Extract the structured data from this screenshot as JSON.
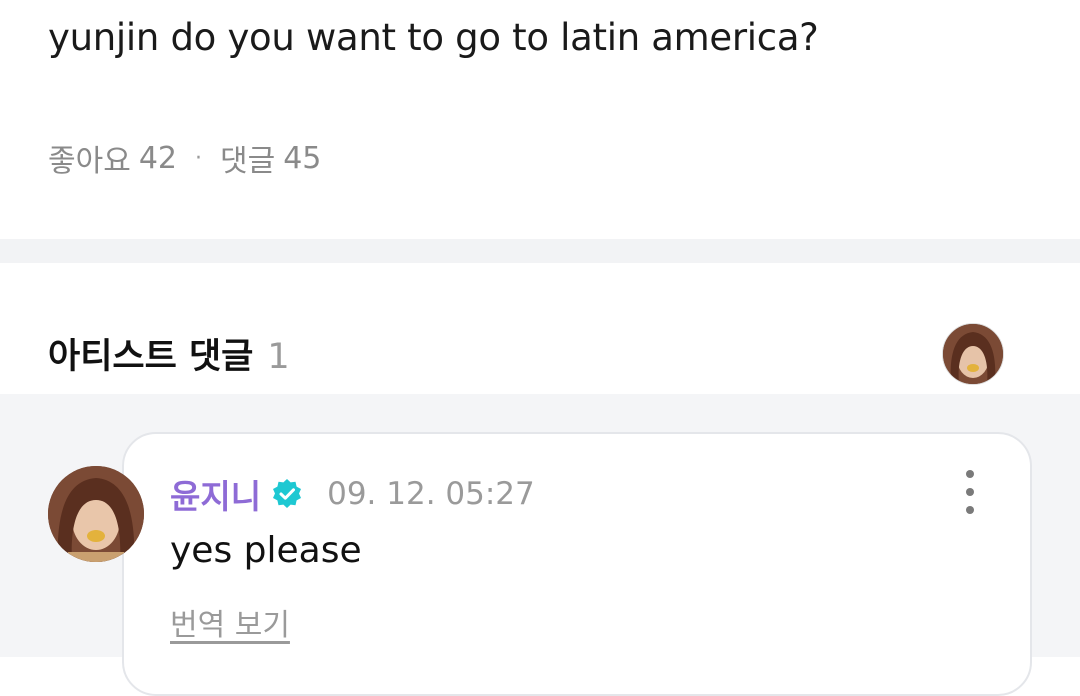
{
  "post": {
    "text": "yunjin do you want to go to latin america?",
    "likes_label": "좋아요",
    "likes_count": "42",
    "separator": "·",
    "comments_label": "댓글",
    "comments_count": "45"
  },
  "artist_comments": {
    "title": "아티스트 댓글",
    "count": "1",
    "items": [
      {
        "author": "윤지니",
        "verified_icon": "verified-badge-icon",
        "timestamp": "09. 12. 05:27",
        "text": "yes please",
        "translate_label": "번역 보기"
      }
    ]
  },
  "colors": {
    "author_name": "#8e6bd6",
    "verified_badge": "#1ec8d2",
    "band": "#f2f3f5"
  }
}
